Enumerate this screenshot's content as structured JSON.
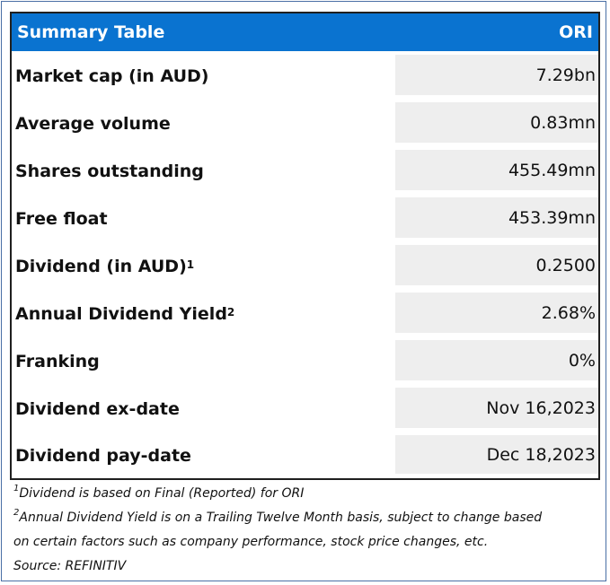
{
  "table": {
    "title": "Summary Table",
    "ticker": "ORI",
    "rows": [
      {
        "label": "Market cap (in AUD)",
        "sup": "",
        "value": "7.29bn"
      },
      {
        "label": "Average volume",
        "sup": "",
        "value": "0.83mn"
      },
      {
        "label": "Shares outstanding",
        "sup": "",
        "value": "455.49mn"
      },
      {
        "label": "Free float",
        "sup": "",
        "value": "453.39mn"
      },
      {
        "label": "Dividend (in AUD)",
        "sup": "1",
        "value": "0.2500"
      },
      {
        "label": "Annual Dividend Yield",
        "sup": "2",
        "value": "2.68%"
      },
      {
        "label": "Franking",
        "sup": "",
        "value": "0%"
      },
      {
        "label": "Dividend ex-date",
        "sup": "",
        "value": "Nov 16,2023"
      },
      {
        "label": "Dividend pay-date",
        "sup": "",
        "value": "Dec 18,2023"
      }
    ]
  },
  "footnotes": {
    "note1_mark": "1",
    "note1": "Dividend is based on Final (Reported) for ORI",
    "note2_mark": "2",
    "note2_line1": "Annual Dividend Yield is on a Trailing Twelve Month basis, subject to change based",
    "note2_line2": "on certain factors such as company performance, stock price changes, etc.",
    "source": "Source: REFINITIV"
  }
}
